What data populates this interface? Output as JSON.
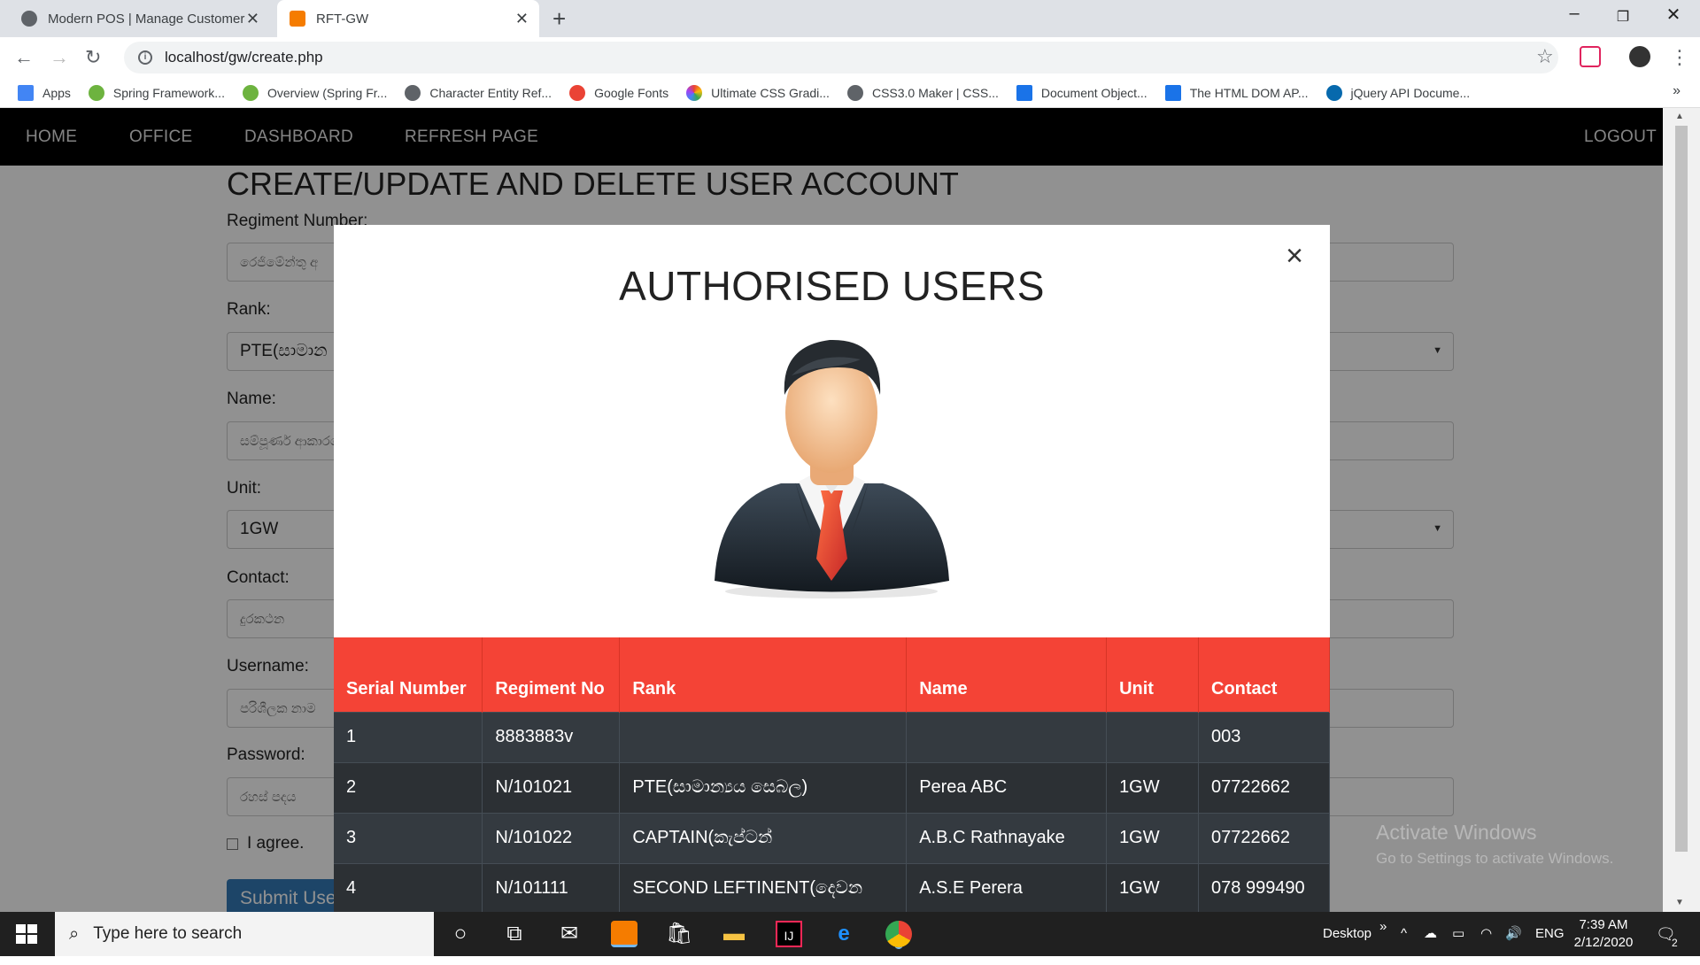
{
  "browser": {
    "tabs": [
      {
        "title": "Modern POS | Manage Customer",
        "favicon_color": "#5f6368"
      },
      {
        "title": "RFT-GW",
        "favicon_color": "#f57c00"
      }
    ],
    "url": "localhost/gw/create.php",
    "bookmarks": [
      {
        "label": "Apps",
        "color": "#4285f4"
      },
      {
        "label": "Spring Framework...",
        "color": "#6db33f"
      },
      {
        "label": "Overview (Spring Fr...",
        "color": "#6db33f"
      },
      {
        "label": "Character Entity Ref...",
        "color": "#5f6368"
      },
      {
        "label": "Google Fonts",
        "color": "#ea4335"
      },
      {
        "label": "Ultimate CSS Gradi...",
        "color": "#a142f4"
      },
      {
        "label": "CSS3.0 Maker | CSS...",
        "color": "#5f6368"
      },
      {
        "label": "Document Object...",
        "color": "#1a73e8"
      },
      {
        "label": "The HTML DOM AP...",
        "color": "#1a73e8"
      },
      {
        "label": "jQuery API Docume...",
        "color": "#0769ad"
      }
    ]
  },
  "nav": {
    "home": "HOME",
    "office": "OFFICE",
    "dashboard": "DASHBOARD",
    "refresh": "REFRESH PAGE",
    "logout": "LOGOUT"
  },
  "form": {
    "title": "CREATE/UPDATE AND DELETE USER ACCOUNT",
    "fields": [
      {
        "label": "Regiment Number:",
        "value": "රෙජිමේන්තු අ"
      },
      {
        "label": "Rank:",
        "value": "PTE(සාමාන"
      },
      {
        "label": "Name:",
        "value": "සම්පූර්ණ ආකාරයෙ"
      },
      {
        "label": "Unit:",
        "value": "1GW"
      },
      {
        "label": "Contact:",
        "value": "දුරකථන"
      },
      {
        "label": "Username:",
        "value": "පරිශීලක නාම"
      },
      {
        "label": "Password:",
        "value": "රහස් පදය"
      }
    ],
    "agree": "I agree.",
    "submit": "Submit Use"
  },
  "modal": {
    "title": "AUTHORISED USERS",
    "columns": [
      "Serial Number",
      "Regiment No",
      "Rank",
      "Name",
      "Unit",
      "Contact"
    ],
    "rows": [
      [
        "1",
        "8883883v",
        "",
        "",
        "",
        "003"
      ],
      [
        "2",
        "N/101021",
        "PTE(සාමාන්‍යය සෙබල)",
        "Perea ABC",
        "1GW",
        "07722662"
      ],
      [
        "3",
        "N/101022",
        "CAPTAIN(කැප්ටන්",
        "A.B.C Rathnayake",
        "1GW",
        "07722662"
      ],
      [
        "4",
        "N/101111",
        "SECOND LEFTINENT(දෙවන",
        "A.S.E Perera",
        "1GW",
        "078 999490"
      ]
    ]
  },
  "watermark": {
    "line1": "Activate Windows",
    "line2": "Go to Settings to activate Windows."
  },
  "taskbar": {
    "search_placeholder": "Type here to search",
    "desktop": "Desktop",
    "lang": "ENG",
    "time": "7:39 AM",
    "date": "2/12/2020",
    "notif_count": "2"
  }
}
